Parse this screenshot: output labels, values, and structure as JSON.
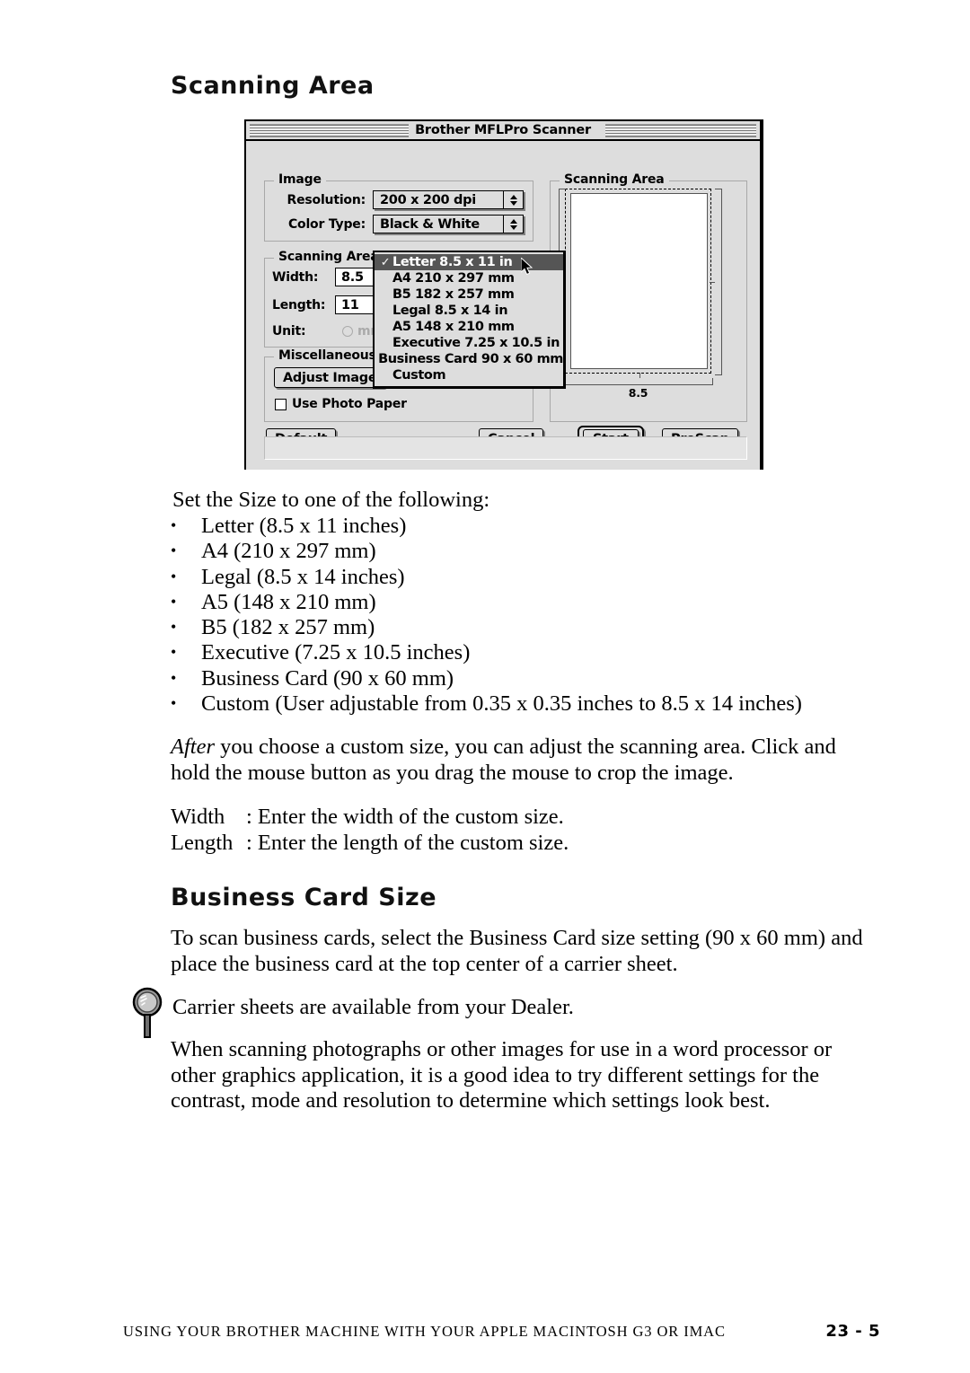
{
  "page": {
    "section_heading": "Scanning Area",
    "business_card_heading": "Business Card Size",
    "intro": "Set the Size to one of the following:",
    "size_list": [
      "Letter (8.5 x 11 inches)",
      "A4 (210 x 297 mm)",
      "Legal (8.5 x 14 inches)",
      "A5 (148 x 210 mm)",
      "B5 (182 x 257 mm)",
      "Executive (7.25 x 10.5 inches)",
      "Business Card (90 x 60 mm)",
      "Custom (User adjustable from 0.35 x 0.35 inches to 8.5 x 14 inches)"
    ],
    "para_after_emphasis": "After",
    "para_after_rest": " you choose a custom size, you can adjust the scanning area. Click and hold the mouse button as you drag the mouse to crop the image.",
    "width_term": "Width",
    "width_def": ": Enter the width of the custom size.",
    "length_term": "Length",
    "length_def": ": Enter the length of the custom size.",
    "para_business": "To scan business cards, select the Business Card size setting (90 x 60 mm) and place the business card at the top center of a carrier sheet.",
    "note_text": "Carrier sheets are available from your Dealer.",
    "para_final": "When scanning photographs or other images for use in a word processor or other graphics application, it is a good idea to try different settings for the contrast, mode and resolution to determine which settings look best."
  },
  "footer": {
    "title": "Using Your Brother Machine With Your Apple Macintosh G3 or iMac",
    "page_number": "23 - 5"
  },
  "dialog": {
    "title": "Brother MFLPro Scanner",
    "image_group": {
      "legend": "Image",
      "resolution_label": "Resolution:",
      "resolution_value": "200 x 200 dpi",
      "color_type_label": "Color Type:",
      "color_type_value": "Black & White"
    },
    "scanarea_group": {
      "legend": "Scanning Area",
      "width_label": "Width:",
      "width_value": "8.5",
      "length_label": "Length:",
      "length_value": "11",
      "unit_label": "Unit:",
      "unit_option": "mm"
    },
    "misc_group": {
      "legend": "Miscellaneous",
      "adjust_image_button": "Adjust Image",
      "use_photo_paper_label": "Use Photo Paper"
    },
    "preview_group": {
      "legend": "Scanning Area",
      "width_dimension": "8.5"
    },
    "buttons": {
      "default": "Default",
      "cancel": "Cancel",
      "start": "Start",
      "prescan": "PreScan"
    },
    "size_menu": {
      "checkmark": "✓",
      "items": [
        {
          "label": "Letter 8.5 x 11 in",
          "selected": true
        },
        {
          "label": "A4 210 x 297 mm",
          "selected": false
        },
        {
          "label": "B5 182 x 257 mm",
          "selected": false
        },
        {
          "label": "Legal 8.5 x 14 in",
          "selected": false
        },
        {
          "label": "A5 148 x 210 mm",
          "selected": false
        },
        {
          "label": "Executive 7.25 x 10.5 in",
          "selected": false
        },
        {
          "label": "Business Card 90 x 60 mm",
          "selected": false
        },
        {
          "label": "Custom",
          "selected": false
        }
      ]
    }
  },
  "colors": {
    "dialog_face": "#dddddd",
    "menu_highlight": "#555555",
    "paper_white": "#ffffff",
    "disabled_gray": "#aaaaaa"
  }
}
